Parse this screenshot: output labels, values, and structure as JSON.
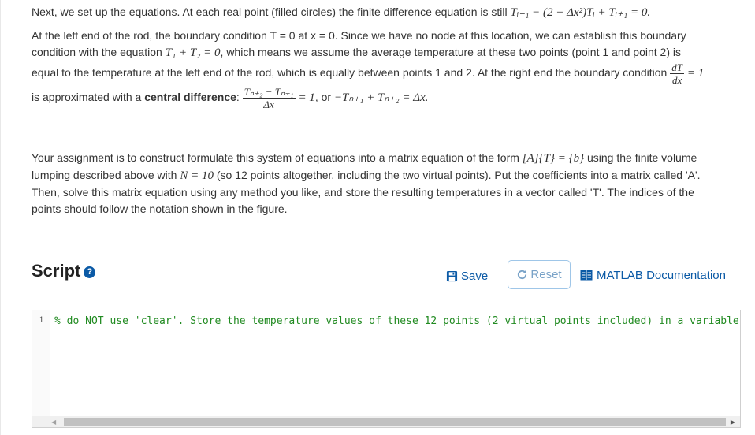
{
  "para1": {
    "text": "Next, we set up the equations. At each real point (filled circles) the finite difference equation is still",
    "eq": "Tᵢ₋₁ − (2 + Δx²)Tᵢ + Tᵢ₊₁ = 0."
  },
  "para2": {
    "a": "At the left end of the rod, the boundary condition T = 0 at x = 0. Since we have no node at this location, we can establish this boundary condition with the equation",
    "eq1": "T₁ + T₂ = 0",
    "b": ", which means we assume the average temperature at these two points (point 1 and point 2) is equal to the temperature at the left end of the rod, which is equally between points 1 and 2. At the right end the boundary condition",
    "frac1_num": "dT",
    "frac1_den": "dx",
    "eq2": "= 1",
    "c": "is approximated with a",
    "bold": "central difference",
    "d": ":",
    "frac2_num": "Tₙ₊₂ − Tₙ₊₁",
    "frac2_den": "Δx",
    "eq3": "= 1",
    "e": ", or",
    "eq4": "−Tₙ₊₁ + Tₙ₊₂ = Δx."
  },
  "para3": {
    "a": "Your assignment is to construct formulate this system of equations into a matrix equation of the form",
    "eq1": "[A]{T} = {b}",
    "b": "using the finite volume lumping described above with",
    "eq2": "N = 10",
    "c": "(so 12 points altogether, including the two virtual points). Put the coefficients into a matrix called 'A'. Then, solve this matrix equation using any method you like, and store the resulting temperatures in a vector called 'T'. The indices of the points should follow the notation shown in the figure."
  },
  "script": {
    "title": "Script",
    "help_icon": "question-circle-icon"
  },
  "toolbar": {
    "save_label": "Save",
    "reset_label": "Reset",
    "docs_label": "MATLAB Documentation"
  },
  "editor": {
    "line_number": "1",
    "code": "% do NOT use 'clear'. Store the temperature values of these 12 points (2 virtual points included) in a variable c"
  },
  "colors": {
    "link": "#0b5aa6",
    "comment": "#228b22",
    "reset_border": "#9fc6e8"
  }
}
